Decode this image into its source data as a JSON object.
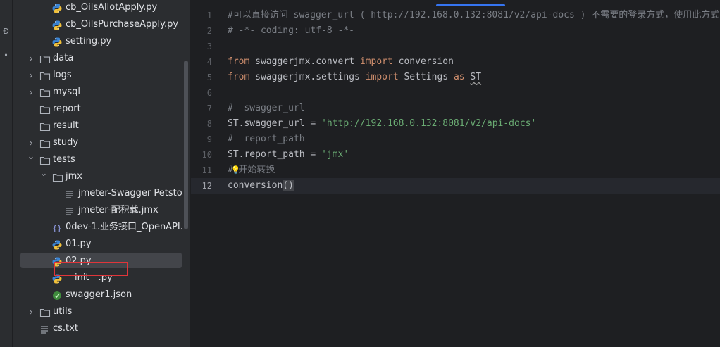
{
  "project_tree": {
    "rows": [
      {
        "label": "cb_OilsAllotApply.py",
        "type": "python",
        "indent": 3,
        "chevron": ""
      },
      {
        "label": "cb_OilsPurchaseApply.py",
        "type": "python",
        "indent": 3,
        "chevron": ""
      },
      {
        "label": "setting.py",
        "type": "python",
        "indent": 3,
        "chevron": ""
      },
      {
        "label": "data",
        "type": "folder",
        "indent": 2,
        "chevron": "right"
      },
      {
        "label": "logs",
        "type": "folder",
        "indent": 2,
        "chevron": "right"
      },
      {
        "label": "mysql",
        "type": "folder",
        "indent": 2,
        "chevron": "right"
      },
      {
        "label": "report",
        "type": "folder",
        "indent": 2,
        "chevron": ""
      },
      {
        "label": "result",
        "type": "folder",
        "indent": 2,
        "chevron": ""
      },
      {
        "label": "study",
        "type": "folder",
        "indent": 2,
        "chevron": "right"
      },
      {
        "label": "tests",
        "type": "folder",
        "indent": 2,
        "chevron": "down"
      },
      {
        "label": "jmx",
        "type": "folder",
        "indent": 3,
        "chevron": "down"
      },
      {
        "label": "jmeter-Swagger Petsto",
        "type": "text",
        "indent": 4,
        "chevron": ""
      },
      {
        "label": "jmeter-配积载.jmx",
        "type": "text",
        "indent": 4,
        "chevron": ""
      },
      {
        "label": "0dev-1.业务接口_OpenAPI.",
        "type": "json",
        "indent": 3,
        "chevron": ""
      },
      {
        "label": "01.py",
        "type": "python",
        "indent": 3,
        "chevron": ""
      },
      {
        "label": "02.py",
        "type": "python",
        "indent": 3,
        "chevron": "",
        "selected": true
      },
      {
        "label": "__init__.py",
        "type": "python",
        "indent": 3,
        "chevron": ""
      },
      {
        "label": "swagger1.json",
        "type": "jsongreen",
        "indent": 3,
        "chevron": ""
      },
      {
        "label": "utils",
        "type": "folder",
        "indent": 2,
        "chevron": "right"
      },
      {
        "label": "cs.txt",
        "type": "text",
        "indent": 2,
        "chevron": ""
      }
    ]
  },
  "left_strip": {
    "glyph_top": "Ð",
    "glyph_mid": "•"
  },
  "editor": {
    "current_line": 12,
    "line_numbers": [
      "1",
      "2",
      "3",
      "4",
      "5",
      "6",
      "7",
      "8",
      "9",
      "10",
      "11",
      "12"
    ],
    "code": {
      "l1": "#可以直接访问 swagger_url ( http://192.168.0.132:8081/v2/api-docs ) 不需要的登录方式，使用此方式",
      "l2": "# -*- coding: utf-8 -*-",
      "l3": "",
      "l4_kw1": "from",
      "l4_mod": " swaggerjmx.convert ",
      "l4_kw2": "import",
      "l4_name": " conversion",
      "l5_kw1": "from",
      "l5_mod": " swaggerjmx.settings ",
      "l5_kw2": "import",
      "l5_name": " Settings ",
      "l5_kw3": "as",
      "l5_alias": "ST",
      "l6": "",
      "l7": "#  swagger_url",
      "l8_lhs": "ST.swagger_url = ",
      "l8_q1": "'",
      "l8_url": "http://192.168.0.132:8081/v2/api-docs",
      "l8_q2": "'",
      "l9": "#  report_path",
      "l10_lhs": "ST.report_path = ",
      "l10_str": "'jmx'",
      "l11_hash": "#",
      "l11_bulb": "💡",
      "l11_text": "开始转换",
      "l12_name": "conversion",
      "l12_parens": "()"
    }
  }
}
